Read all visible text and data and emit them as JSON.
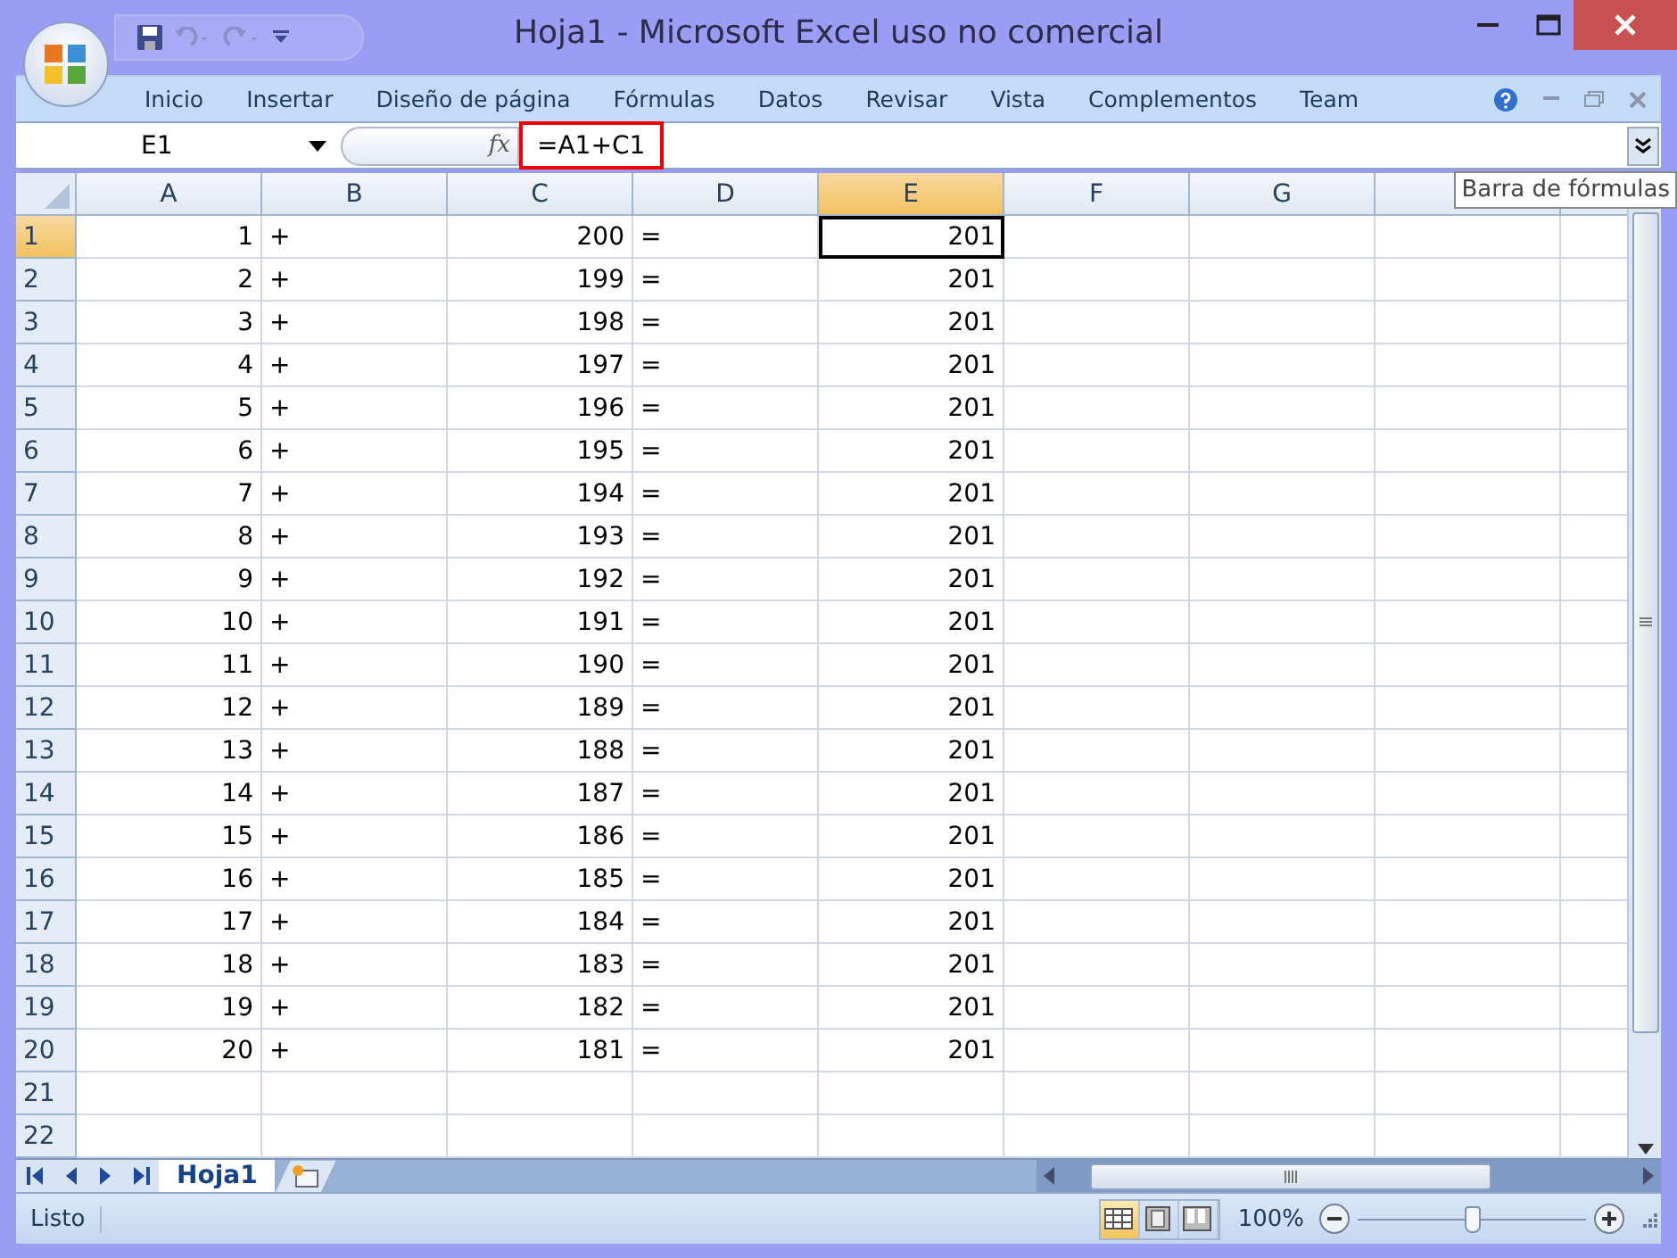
{
  "window": {
    "title": "Hoja1 - Microsoft Excel uso no comercial"
  },
  "ribbon_tabs": [
    "Inicio",
    "Insertar",
    "Diseño de página",
    "Fórmulas",
    "Datos",
    "Revisar",
    "Vista",
    "Complementos",
    "Team"
  ],
  "formula_bar": {
    "name_box": "E1",
    "fx": "fx",
    "formula": "=A1+C1",
    "tooltip": "Barra de fórmulas"
  },
  "columns": [
    {
      "label": "A",
      "selected": false
    },
    {
      "label": "B",
      "selected": false
    },
    {
      "label": "C",
      "selected": false
    },
    {
      "label": "D",
      "selected": false
    },
    {
      "label": "E",
      "selected": true
    },
    {
      "label": "F",
      "selected": false
    },
    {
      "label": "G",
      "selected": false
    }
  ],
  "rows": [
    {
      "label": "1",
      "selected": true,
      "cells": [
        "1",
        "+",
        "200",
        "=",
        "201"
      ]
    },
    {
      "label": "2",
      "selected": false,
      "cells": [
        "2",
        "+",
        "199",
        "=",
        "201"
      ]
    },
    {
      "label": "3",
      "selected": false,
      "cells": [
        "3",
        "+",
        "198",
        "=",
        "201"
      ]
    },
    {
      "label": "4",
      "selected": false,
      "cells": [
        "4",
        "+",
        "197",
        "=",
        "201"
      ]
    },
    {
      "label": "5",
      "selected": false,
      "cells": [
        "5",
        "+",
        "196",
        "=",
        "201"
      ]
    },
    {
      "label": "6",
      "selected": false,
      "cells": [
        "6",
        "+",
        "195",
        "=",
        "201"
      ]
    },
    {
      "label": "7",
      "selected": false,
      "cells": [
        "7",
        "+",
        "194",
        "=",
        "201"
      ]
    },
    {
      "label": "8",
      "selected": false,
      "cells": [
        "8",
        "+",
        "193",
        "=",
        "201"
      ]
    },
    {
      "label": "9",
      "selected": false,
      "cells": [
        "9",
        "+",
        "192",
        "=",
        "201"
      ]
    },
    {
      "label": "10",
      "selected": false,
      "cells": [
        "10",
        "+",
        "191",
        "=",
        "201"
      ]
    },
    {
      "label": "11",
      "selected": false,
      "cells": [
        "11",
        "+",
        "190",
        "=",
        "201"
      ]
    },
    {
      "label": "12",
      "selected": false,
      "cells": [
        "12",
        "+",
        "189",
        "=",
        "201"
      ]
    },
    {
      "label": "13",
      "selected": false,
      "cells": [
        "13",
        "+",
        "188",
        "=",
        "201"
      ]
    },
    {
      "label": "14",
      "selected": false,
      "cells": [
        "14",
        "+",
        "187",
        "=",
        "201"
      ]
    },
    {
      "label": "15",
      "selected": false,
      "cells": [
        "15",
        "+",
        "186",
        "=",
        "201"
      ]
    },
    {
      "label": "16",
      "selected": false,
      "cells": [
        "16",
        "+",
        "185",
        "=",
        "201"
      ]
    },
    {
      "label": "17",
      "selected": false,
      "cells": [
        "17",
        "+",
        "184",
        "=",
        "201"
      ]
    },
    {
      "label": "18",
      "selected": false,
      "cells": [
        "18",
        "+",
        "183",
        "=",
        "201"
      ]
    },
    {
      "label": "19",
      "selected": false,
      "cells": [
        "19",
        "+",
        "182",
        "=",
        "201"
      ]
    },
    {
      "label": "20",
      "selected": false,
      "cells": [
        "20",
        "+",
        "181",
        "=",
        "201"
      ]
    },
    {
      "label": "21",
      "selected": false
    },
    {
      "label": "22",
      "selected": false
    }
  ],
  "sheet_tabs": [
    {
      "label": "Hoja1",
      "selected": true
    }
  ],
  "status_bar": {
    "status": "Listo",
    "views": [
      {
        "kind": "normal",
        "selected": true
      },
      {
        "kind": "layout",
        "selected": false
      },
      {
        "kind": "pagebreak",
        "selected": false
      }
    ],
    "zoom": "100%",
    "zoom_slider": {
      "level": 0.5
    }
  }
}
